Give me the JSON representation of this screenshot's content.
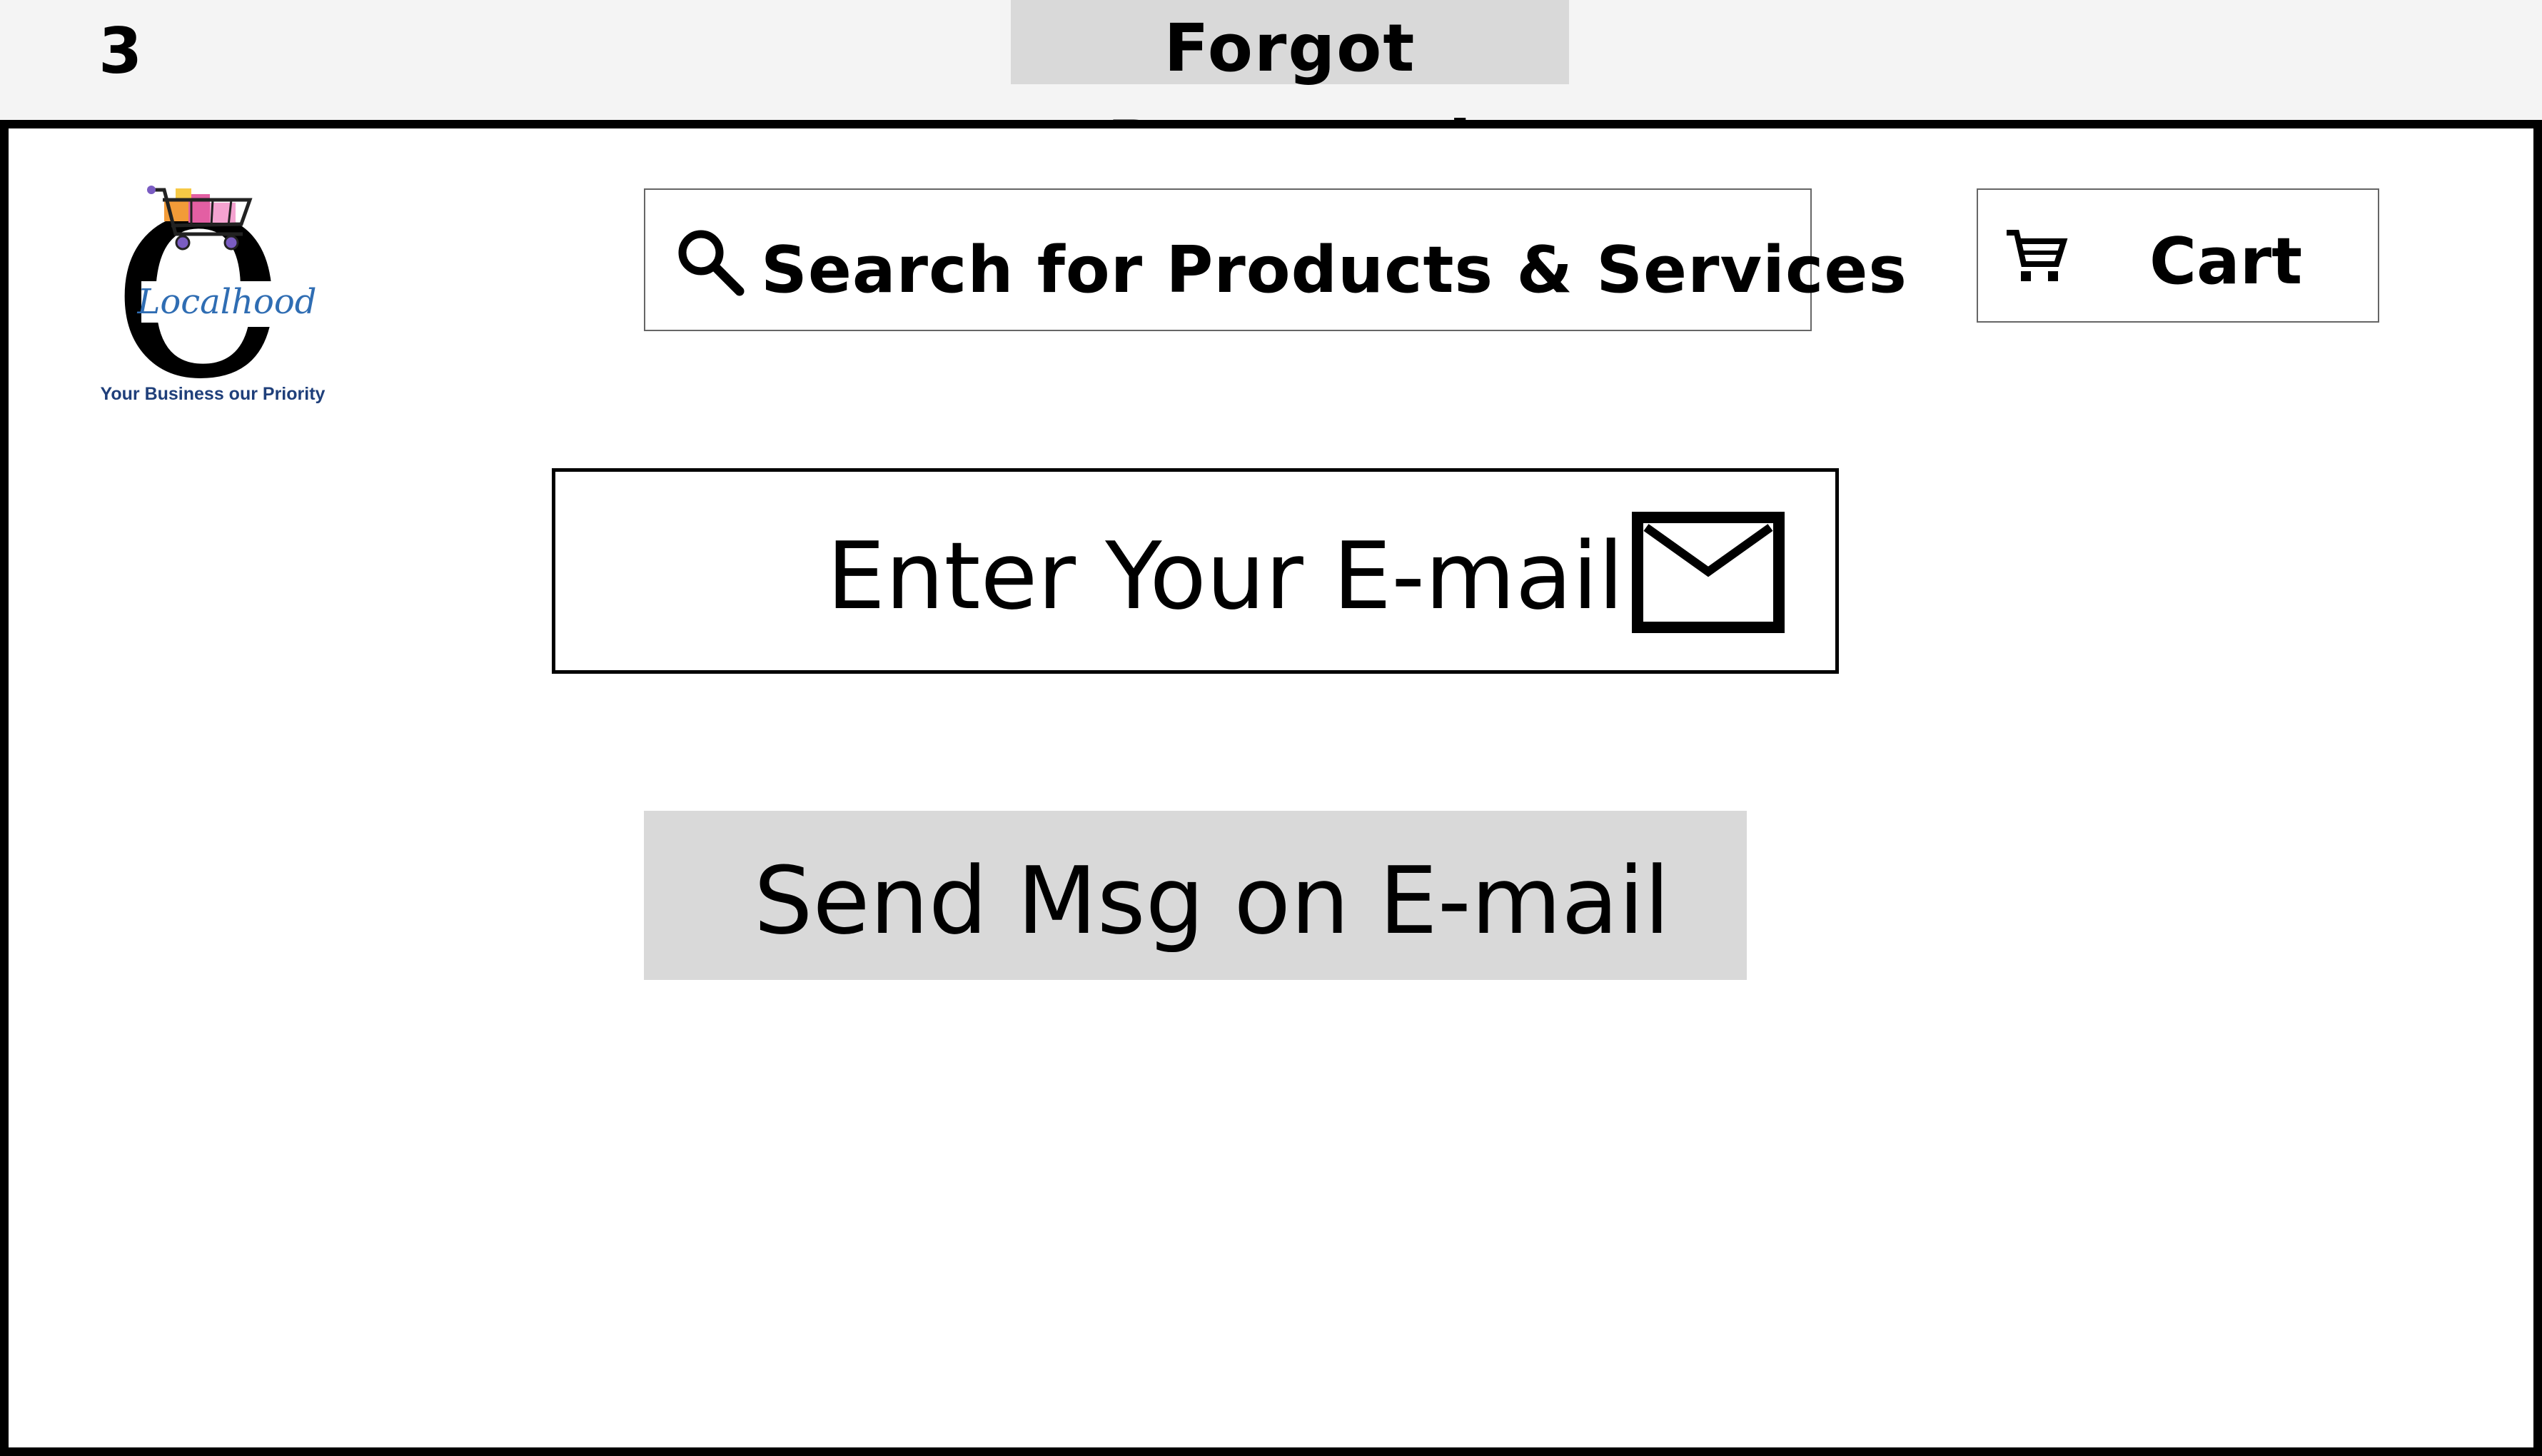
{
  "header": {
    "page_number": "3",
    "title": "Forgot Password"
  },
  "logo": {
    "letter": "e",
    "brand": "Localhood",
    "tagline": "Your Business our Priority"
  },
  "search": {
    "label": "Search for Products & Services",
    "icon": "search-icon"
  },
  "cart": {
    "label": "Cart",
    "icon": "cart-icon"
  },
  "email_field": {
    "placeholder": "Enter Your E-mail",
    "icon": "mail-icon"
  },
  "send_button": {
    "label": "Send Msg on E-mail"
  },
  "colors": {
    "title_bg": "#d9d9d9",
    "button_bg": "#d9d9d9",
    "frame_border": "#000000",
    "brand_blue": "#2f6db3"
  }
}
